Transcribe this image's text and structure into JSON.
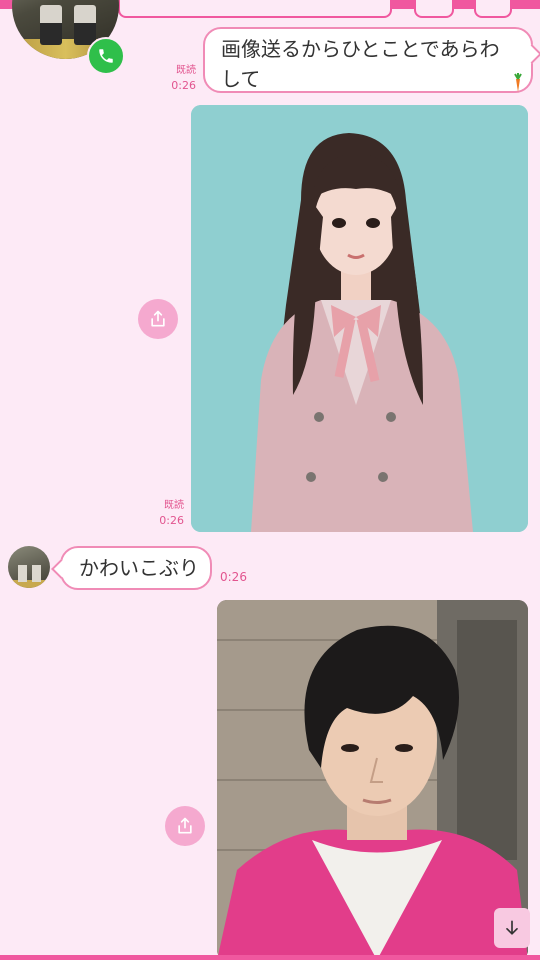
{
  "messages": [
    {
      "direction": "out",
      "type": "text",
      "text": "画像送るからひとことであらわして",
      "read": "既読",
      "time": "0:26",
      "sticker": "carrot-icon"
    },
    {
      "direction": "out",
      "type": "image",
      "subject": "girl-in-pink-blazer-photo",
      "read": "既読",
      "time": "0:26"
    },
    {
      "direction": "in",
      "type": "text",
      "text": "かわいこぶり",
      "time": "0:26"
    },
    {
      "direction": "out",
      "type": "image",
      "subject": "young-man-dark-hair-photo"
    }
  ],
  "icons": {
    "call": "phone-icon",
    "share": "share-icon",
    "scroll": "arrow-down-icon"
  },
  "colors": {
    "background": "#fdeaf6",
    "accent": "#f0589f",
    "bubble_border": "#f08bb6",
    "meta_text": "#e2558f",
    "call_badge": "#2fbf4a",
    "share_button": "#f5a9cf"
  }
}
